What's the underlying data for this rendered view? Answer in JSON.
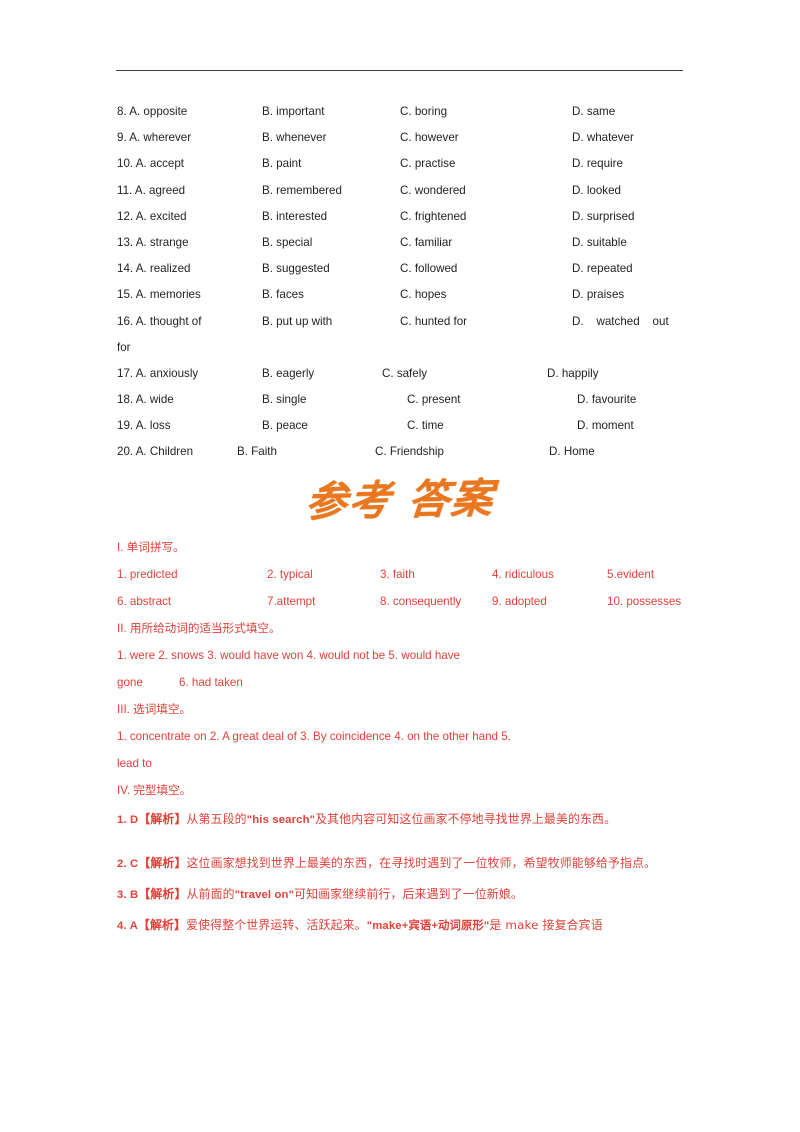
{
  "page": {
    "background": "#ffffff",
    "rule_color": "#3d3d3d",
    "black_text_color": "#231f20",
    "red_text_color": "#e2413a",
    "orange_title_color": "#e8771f"
  },
  "cloze_options": {
    "rows": [
      {
        "num": "8.",
        "a": "8. A. opposite",
        "b": "B. important",
        "c": "C. boring",
        "d": "D. same"
      },
      {
        "num": "9.",
        "a": "9. A. wherever",
        "b": "B. whenever",
        "c": "C. however",
        "d": "D. whatever"
      },
      {
        "num": "10.",
        "a": "10. A. accept",
        "b": "B. paint",
        "c": "C. practise",
        "d": "D. require"
      },
      {
        "num": "11.",
        "a": "11. A. agreed",
        "b": "B. remembered",
        "c": "C. wondered",
        "d": "D. looked"
      },
      {
        "num": "12.",
        "a": "12. A. excited",
        "b": "B. interested",
        "c": "C. frightened",
        "d": "D. surprised"
      },
      {
        "num": "13.",
        "a": "13. A. strange",
        "b": "B. special",
        "c": "C. familiar",
        "d": "D. suitable"
      },
      {
        "num": "14.",
        "a": "14. A. realized",
        "b": "B. suggested",
        "c": "C. followed",
        "d": "D. repeated"
      },
      {
        "num": "15.",
        "a": "15. A. memories",
        "b": "B. faces",
        "c": "C. hopes",
        "d": "D. praises"
      },
      {
        "num": "16.",
        "a": "16. A. thought of",
        "b": "B. put up with",
        "c": "C. hunted for",
        "d": "D.    watched    out"
      },
      {
        "num": "17.",
        "a": "17. A. anxiously",
        "b": "B. eagerly",
        "c": "C. safely",
        "d": "D. happily"
      },
      {
        "num": "18.",
        "a": "18. A. wide",
        "b": "B. single",
        "c": "C. present",
        "d": "D. favourite"
      },
      {
        "num": "19.",
        "a": "19. A. loss",
        "b": "B. peace",
        "c": "C. time",
        "d": "D. moment"
      },
      {
        "num": "20.",
        "a": "20. A. Children",
        "b": "B. Faith",
        "c": "C. Friendship",
        "d": "D. Home"
      }
    ],
    "row16_continuation": "for"
  },
  "seal": {
    "title": "参考 答案"
  },
  "section_1": {
    "heading": "I. 单词拼写。",
    "row1": [
      "1. predicted",
      "2. typical",
      "3. faith",
      "4. ridiculous",
      "5.evident"
    ],
    "row2": [
      "6. abstract",
      "7.attempt",
      "8. consequently",
      "9. adopted",
      "10. possesses"
    ]
  },
  "section_2": {
    "heading": "II. 用所给动词的适当形式填空。",
    "row1": [
      "1. were",
      "2. snows",
      "3. would have won",
      "4. would not be",
      "5.",
      "would",
      "have"
    ],
    "row2": [
      "gone",
      "6. had taken"
    ]
  },
  "section_3": {
    "heading": "III. 选词填空。",
    "row1": [
      "1. concentrate on",
      "2. A great deal of",
      "3. By coincidence",
      "4. on the other hand",
      "5."
    ],
    "row2": [
      "lead to"
    ]
  },
  "section_4": {
    "heading": "IV. 完型填空。",
    "items": [
      {
        "label": "1. D",
        "bracket": "【解析】",
        "text_1": "从第五段的",
        "quote_1": "\"his search\"",
        "text_2": "及其他内容可知这位画家不停地寻找世界上最美的东西。"
      },
      {
        "label": "2. C",
        "bracket": "【解析】",
        "text_1": "这位画家想找到世界上最美的东西，在寻找时遇到了一位牧师，希望牧师能够给予指点。",
        "quote_1": "",
        "text_2": ""
      },
      {
        "label": "3. B",
        "bracket": "【解析】",
        "text_1": "从前面的",
        "quote_1": "\"travel on\"",
        "text_2": "可知画家继续前行，后来遇到了一位新娘。"
      },
      {
        "label": "4. A",
        "bracket": "【解析】",
        "text_1": "爱使得整个世界运转、活跃起来。",
        "quote_1": "\"make+宾语+动词原形\"",
        "text_2": "是 make 接复合宾语"
      }
    ]
  }
}
